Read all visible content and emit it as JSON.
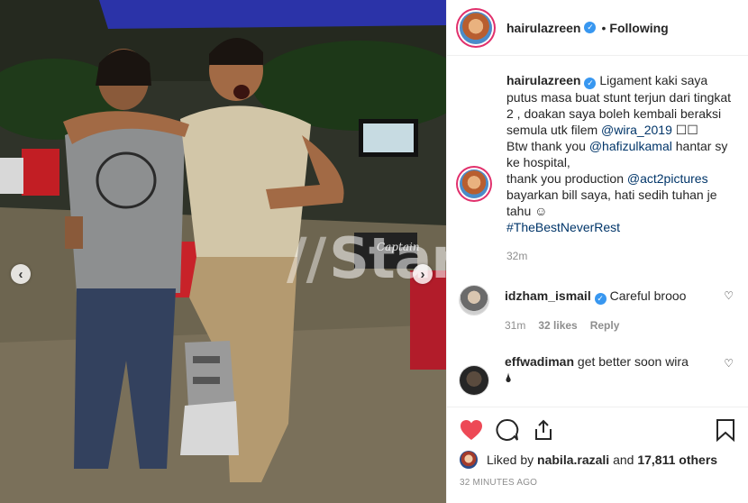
{
  "header": {
    "username": "hairulazreen",
    "separator": "•",
    "follow_label": "Following"
  },
  "photo": {
    "watermark_text": "Star",
    "sign_text": "Captain",
    "prev_glyph": "‹",
    "next_glyph": "›"
  },
  "caption": {
    "username": "hairulazreen",
    "text_1": "Ligament kaki saya putus masa buat stunt terjun dari tingkat 2 , doakan saya boleh kembali beraksi semula utk filem",
    "mention_1": "@wira_2019",
    "text_1b": "☐☐",
    "text_2": "Btw thank you",
    "mention_2": "@hafizulkamal",
    "text_3": "hantar sy ke hospital,",
    "text_4": "thank you production",
    "mention_3": "@act2pictures",
    "text_5": "bayarkan bill saya, hati sedih tuhan je tahu ☺",
    "hashtag": "#TheBestNeverRest",
    "time": "32m"
  },
  "comments": [
    {
      "username": "idzham_ismail",
      "text": "Careful brooo",
      "time": "31m",
      "likes": "32 likes",
      "reply_label": "Reply"
    },
    {
      "username": "effwadiman",
      "text": "get better soon wira",
      "text_2": "🌢"
    }
  ],
  "likes": {
    "prefix": "Liked by",
    "user": "nabila.razali",
    "middle": "and",
    "count": "17,811 others"
  },
  "timestamp": "32 MINUTES AGO",
  "colors": {
    "like_red": "#ed4956",
    "verified_blue": "#3897f0",
    "link": "#003569",
    "muted": "#8e8e8e"
  }
}
